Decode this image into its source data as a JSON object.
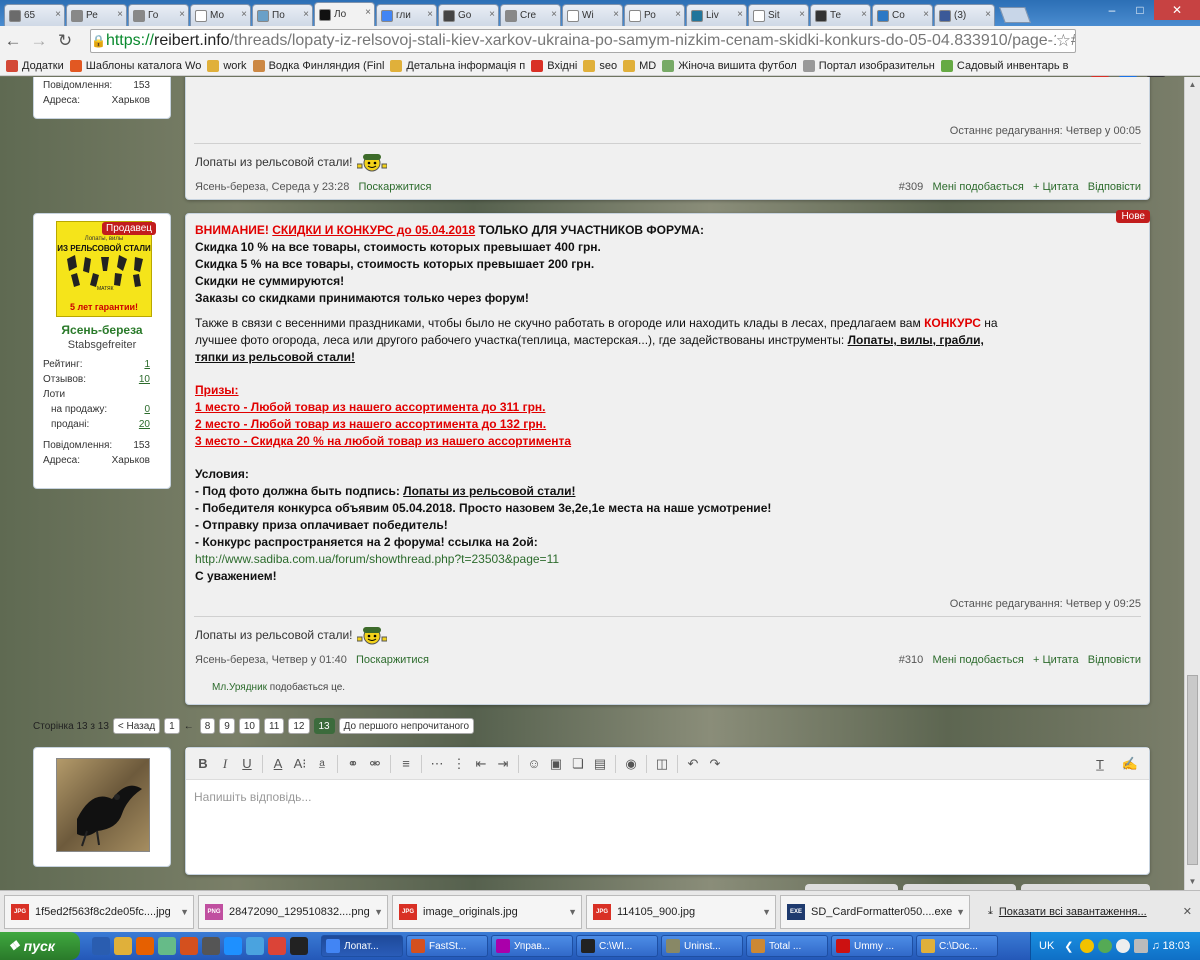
{
  "tabs": [
    {
      "label": "65",
      "color": "#6b6b6b"
    },
    {
      "label": "Ре",
      "color": "#888"
    },
    {
      "label": "Го",
      "color": "#888"
    },
    {
      "label": "Мо",
      "color": "#ffffff"
    },
    {
      "label": "По",
      "color": "#6aa0c8"
    },
    {
      "label": "Ло",
      "color": "#111"
    },
    {
      "label": "гли",
      "color": "#4285f4"
    },
    {
      "label": "Go",
      "color": "#444"
    },
    {
      "label": "Cre",
      "color": "#888"
    },
    {
      "label": "Wi",
      "color": "#ffffff"
    },
    {
      "label": "Ро",
      "color": "#ffffff"
    },
    {
      "label": "Liv",
      "color": "#21759b"
    },
    {
      "label": "Sit",
      "color": "#ffffff"
    },
    {
      "label": "Те",
      "color": "#333"
    },
    {
      "label": "Со",
      "color": "#2b78c5"
    },
    {
      "label": "(3)",
      "color": "#3b5998"
    }
  ],
  "url": {
    "scheme": "https://",
    "host": "reibert.info",
    "path": "/threads/lopaty-iz-relsovoj-stali-kiev-xarkov-ukraina-po-samym-nizkim-cenam-skidki-konkurs-do-05-04.833910/page-13#p"
  },
  "extensions": [
    {
      "badge": "6",
      "color": "#d93025"
    },
    {
      "badge": "6",
      "color": "#1a73e8"
    },
    {
      "badge": "6",
      "color": "#333"
    }
  ],
  "bookmarks": [
    {
      "label": "Додатки",
      "color": "#d34836"
    },
    {
      "label": "Шаблоны каталога Wo",
      "color": "#e25822"
    },
    {
      "label": "work",
      "color": "#e0b03a"
    },
    {
      "label": "Водка Финляндия (Finl",
      "color": "#c84"
    },
    {
      "label": "Детальна інформація п",
      "color": "#e0b03a"
    },
    {
      "label": "Вхідні",
      "color": "#d93025"
    },
    {
      "label": "seo",
      "color": "#e0b03a"
    },
    {
      "label": "MD",
      "color": "#e0b03a"
    },
    {
      "label": "Жіноча вишита футбол",
      "color": "#7a6"
    },
    {
      "label": "Портал изобразительн",
      "color": "#999"
    },
    {
      "label": "Садовый инвентарь в",
      "color": "#6a4"
    }
  ],
  "prev_post": {
    "stats": [
      {
        "k": "Повідомлення:",
        "v": "153"
      },
      {
        "k": "Адреса:",
        "v": "Харьков"
      }
    ],
    "edited_label": "Останнє редагування:",
    "edited_value": "Четвер у 00:05",
    "signature": "Лопаты из рельсовой стали!",
    "author": "Ясень-береза",
    "date": "Середа у 23:28",
    "report": "Поскаржитися",
    "number": "#309",
    "like": "Мені подобається",
    "quote": "+ Цитата",
    "reply": "Відповісти"
  },
  "post": {
    "seller_badge": "Продавец",
    "avatar_top": "Лопаты, вилы",
    "avatar_text": "ИЗ РЕЛЬСОВОЙ СТАЛИ",
    "avatar_sub": "5 лет гарантии!",
    "avatar_brand": "МАТЯК",
    "username": "Ясень-береза",
    "usertitle": "Stabsgefreiter",
    "stats": [
      {
        "k": "Рейтинг:",
        "v": "1",
        "link": true
      },
      {
        "k": "Отзывов:",
        "v": "10",
        "link": true
      },
      {
        "k": "Лоти",
        "v": "",
        "link": false
      },
      {
        "k": "на продажу:",
        "v": "0",
        "link": true,
        "indent": true
      },
      {
        "k": "продані:",
        "v": "20",
        "link": true,
        "indent": true
      },
      {
        "k": "Повідомлення:",
        "v": "153",
        "link": false
      },
      {
        "k": "Адреса:",
        "v": "Харьков",
        "link": false
      }
    ],
    "new_badge": "Нове",
    "l1a": "ВНИМАНИЕ!",
    "l1b": "СКИДКИ И КОНКУРС до 05.04.2018",
    "l1c": " ТОЛЬКО ДЛЯ УЧАСТНИКОВ ФОРУМА:",
    "l2": "Скидка 10 % на все товары, стоимость которых превышает 400 грн.",
    "l3": "Скидка 5 % на все товары, стоимость которых превышает 200 грн.",
    "l4": "Скидки не суммируются!",
    "l5": "Заказы со скидками принимаются только через форум!",
    "p1a": "Также в связи с весенними праздниками, чтобы было не скучно работать в огороде или находить клады в лесах, предлагаем вам ",
    "p1b": "КОНКУРС",
    "p1c": " на",
    "p2a": "лучшее фото огорода, леса или другого рабочего участка(теплица, мастерская...), где задействованы инструменты: ",
    "p2b": "Лопаты, вилы, грабли,",
    "p3": "тяпки из рельсовой стали!",
    "prizes_title": "Призы: ",
    "prize1": "1 место - Любой товар из нашего ассортимента до 311 грн.",
    "prize2": "2 место - Любой товар из нашего ассортимента до 132 грн.",
    "prize3": "3 место - Скидка 20 % на любой товар из нашего ассортимента",
    "cond_title": "Условия:",
    "c1a": "- Под фото должна быть подпись: ",
    "c1b": "Лопаты из рельсовой стали!",
    "c2": "- Победителя конкурса объявим 05.04.2018. Просто назовем 3е,2е,1е места на наше усмотрение!",
    "c3": "- Отправку приза оплачивает победитель!",
    "c4": "- Конкурс распространяется на 2 форума! ссылка на 2ой:",
    "link": "http://www.sadiba.com.ua/forum/showthread.php?t=23503&page=11",
    "regards": "С уважением!",
    "edited_label": "Останнє редагування:",
    "edited_value": "Четвер у 09:25",
    "signature": "Лопаты из рельсовой стали!",
    "author": "Ясень-береза",
    "date": "Четвер у 01:40",
    "report": "Поскаржитися",
    "number": "#310",
    "like": "Мені подобається",
    "quote": "+ Цитата",
    "reply": "Відповісти",
    "liker": "Мл.Урядник",
    "liked_text": " подобається це."
  },
  "pager": {
    "label": "Сторінка 13 з 13",
    "prev": "< Назад",
    "first": "1",
    "ellipsis": "←",
    "pages": [
      "8",
      "9",
      "10",
      "11",
      "12"
    ],
    "current": "13",
    "unread": "До першого непрочитаного"
  },
  "editor": {
    "placeholder": "Напишіть відповідь..."
  },
  "downloads": [
    {
      "name": "1f5ed2f563f8c2de05fc....jpg",
      "type": "JPG",
      "color": "#d93025"
    },
    {
      "name": "28472090_129510832....png",
      "type": "PNG",
      "color": "#c04fa0"
    },
    {
      "name": "image_originals.jpg",
      "type": "JPG",
      "color": "#d93025"
    },
    {
      "name": "114105_900.jpg",
      "type": "JPG",
      "color": "#d93025"
    },
    {
      "name": "SD_CardFormatter050....exe",
      "type": "EXE",
      "color": "#1e3a6e"
    }
  ],
  "show_all_downloads": "Показати всі завантаження...",
  "taskbar": {
    "start": "пуск",
    "tasks": [
      {
        "label": "Лопат...",
        "color": "#4285f4",
        "active": true
      },
      {
        "label": "FastSt...",
        "color": "#d4501e"
      },
      {
        "label": "Управ...",
        "color": "#a0a"
      },
      {
        "label": "C:\\WI...",
        "color": "#222"
      },
      {
        "label": "Uninst...",
        "color": "#886"
      },
      {
        "label": "Total ...",
        "color": "#c83"
      },
      {
        "label": "Ummy ...",
        "color": "#c11"
      },
      {
        "label": "C:\\Doc...",
        "color": "#e0b03a"
      }
    ],
    "lang": "UK",
    "time": "18:03"
  }
}
